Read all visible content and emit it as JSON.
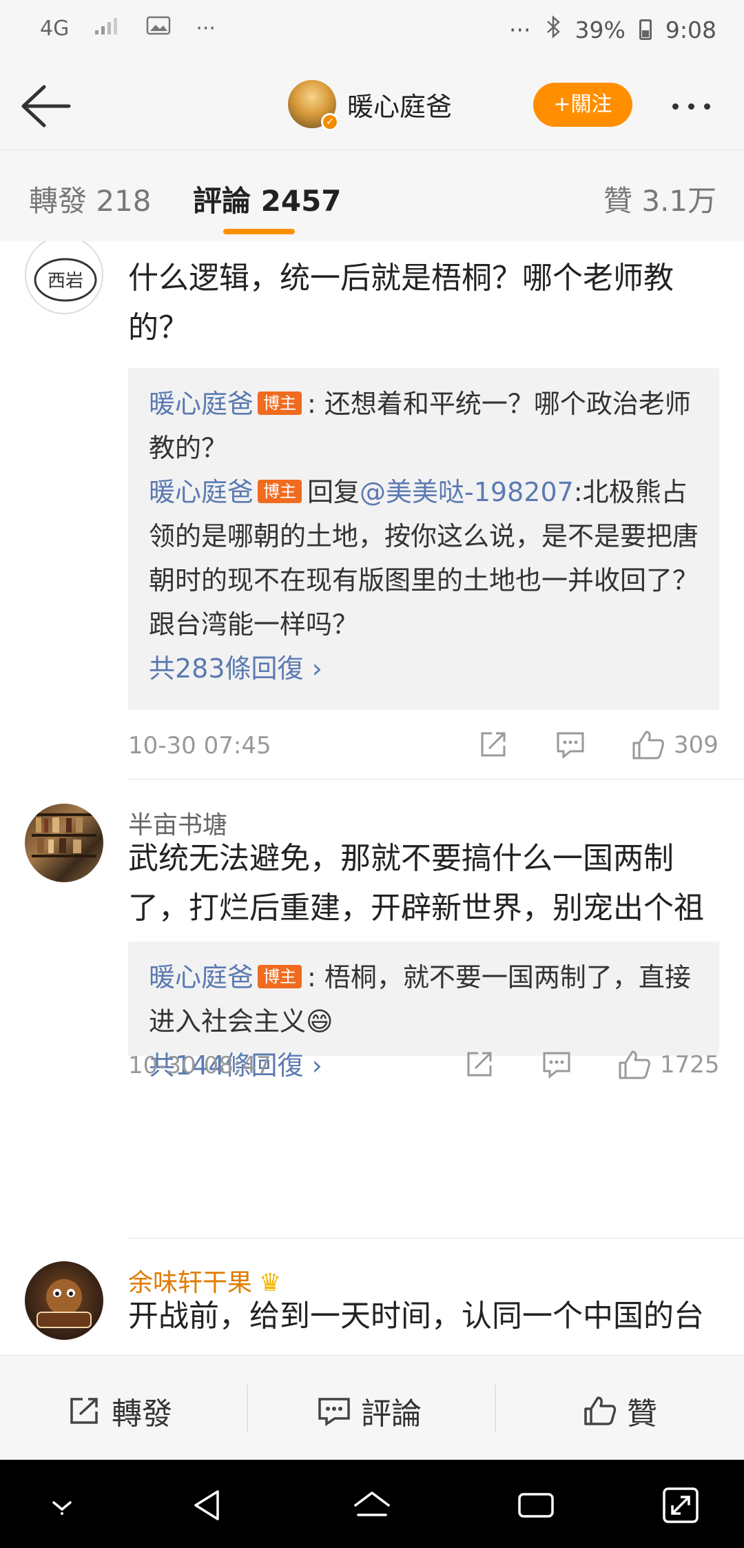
{
  "status_bar": {
    "network": "4G",
    "more": "···",
    "battery_pct": "39%",
    "time": "9:08"
  },
  "header": {
    "title": "暖心庭爸",
    "follow_label": "+關注"
  },
  "tabs": {
    "repost": "轉發 218",
    "comments": "評論 2457",
    "likes": "贊 3.1万"
  },
  "comments": [
    {
      "user": "",
      "text": "什么逻辑，统一后就是梧桐？哪个老师教的？",
      "replies": [
        {
          "name": "暖心庭爸",
          "badge": "博主",
          "text": ": 还想着和平统一？哪个政治老师教的？"
        },
        {
          "name": "暖心庭爸",
          "badge": "博主",
          "prefix": "回复",
          "mention": "@美美哒-198207",
          "text": ":北极熊占领的是哪朝的土地，按你这么说，是不是要把唐朝时的现不在现有版图里的土地也一并收回了？跟台湾能一样吗？"
        }
      ],
      "more_replies": "共283條回復",
      "time": "10-30 07:45",
      "likes": "309"
    },
    {
      "user": "半亩书塘",
      "text": "武统无法避免，那就不要搞什么一国两制了，打烂后重建，开辟新世界，别宠出个祖宗来，像香港一样白眼狼",
      "replies": [
        {
          "name": "暖心庭爸",
          "badge": "博主",
          "text": ": 梧桐，就不要一国两制了，直接进入社会主义😄"
        }
      ],
      "more_replies": "共144條回復",
      "time": "10-30 08:47",
      "likes": "1725"
    },
    {
      "user": "余味轩干果",
      "text": "开战前，给到一天时间，认同一个中国的台"
    }
  ],
  "action_bar": {
    "repost": "轉發",
    "comment": "評論",
    "like": "贊"
  },
  "colors": {
    "accent": "#ff8f00",
    "link": "#5b7ab1",
    "badge": "#f06b1f"
  }
}
